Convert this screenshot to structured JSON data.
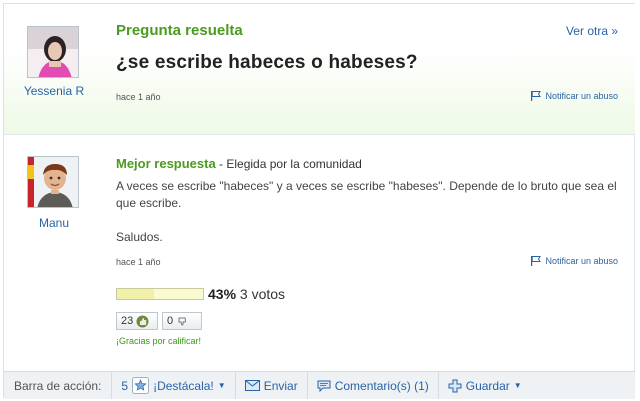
{
  "question": {
    "status_title": "Pregunta resuelta",
    "next_link": "Ver otra »",
    "text": "¿se escribe habeces o habeses?",
    "time": "hace 1 año",
    "report": "Notificar un abuso",
    "asker": "Yessenia R"
  },
  "answer": {
    "best_label": "Mejor respuesta",
    "chosen_by": " - Elegida por la comunidad",
    "body": "A veces se escribe \"habeces\" y a veces se escribe \"habeses\". Depende de lo bruto que sea el que escribe.",
    "signoff": "Saludos.",
    "time": "hace 1 año",
    "report": "Notificar un abuso",
    "answerer": "Manu",
    "rating_percent": 43,
    "rating_percent_label": "43%",
    "votes_label": "3 votos",
    "thumbs_up": "23",
    "thumbs_down": "0",
    "thanks": "¡Gracias por calificar!"
  },
  "actionbar": {
    "label": "Barra de acción:",
    "star_count": "5",
    "highlight": "¡Destácala!",
    "send": "Enviar",
    "comments": "Comentario(s) (1)",
    "save": "Guardar"
  },
  "colors": {
    "green": "#4a9b1f",
    "link": "#2a63a6"
  }
}
